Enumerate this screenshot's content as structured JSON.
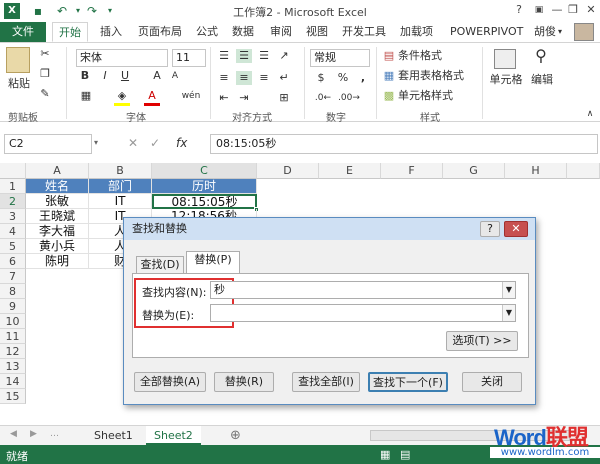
{
  "window": {
    "title": "工作簿2 - Microsoft Excel",
    "help": "?",
    "minimize": "—",
    "restore": "❐",
    "close": "✕"
  },
  "ribbon_tabs": {
    "file": "文件",
    "items": [
      "开始",
      "插入",
      "页面布局",
      "公式",
      "数据",
      "审阅",
      "视图",
      "开发工具",
      "加载项",
      "POWERPIVOT"
    ],
    "user": "胡俊"
  },
  "ribbon": {
    "paste": "粘贴",
    "clipboard": "剪贴板",
    "font_name": "宋体",
    "font_size": "11",
    "bold": "B",
    "italic": "I",
    "underline": "U",
    "font_color_letter": "A",
    "pinyin": "wén",
    "font_group": "字体",
    "align_group": "对齐方式",
    "number_format": "常规",
    "percent": "%",
    "comma": ",",
    "number_group": "数字",
    "cond_format": "条件格式",
    "table_format": "套用表格格式",
    "cell_style": "单元格样式",
    "style_group": "样式",
    "cells": "单元格",
    "edit": "编辑"
  },
  "formula_bar": {
    "name_box": "C2",
    "cancel": "✕",
    "enter": "✓",
    "fx": "fx",
    "value": "08:15:05秒"
  },
  "sheet": {
    "columns": [
      "A",
      "B",
      "C",
      "D",
      "E",
      "F",
      "G",
      "H"
    ],
    "rows": [
      "1",
      "2",
      "3",
      "4",
      "5",
      "6",
      "7",
      "8",
      "9",
      "10",
      "11",
      "12",
      "13",
      "14",
      "15"
    ],
    "headers": [
      "姓名",
      "部门",
      "历时"
    ],
    "data": [
      [
        "张敏",
        "IT",
        "08:15:05秒"
      ],
      [
        "王晓斌",
        "IT",
        "12:18:56秒"
      ],
      [
        "李大福",
        "人",
        ""
      ],
      [
        "黄小兵",
        "人",
        ""
      ],
      [
        "陈明",
        "财",
        ""
      ]
    ]
  },
  "sheet_tabs": {
    "items": [
      "Sheet1",
      "Sheet2"
    ],
    "active": "Sheet2",
    "add": "⊕"
  },
  "status": {
    "ready": "就绪"
  },
  "watermark": {
    "brand_a": "Word",
    "brand_b": "联盟",
    "url": "www.wordlm.com"
  },
  "dialog": {
    "title": "查找和替换",
    "help": "?",
    "close": "✕",
    "tabs": [
      "查找(D)",
      "替换(P)"
    ],
    "find_label": "查找内容(N):",
    "find_value": "秒",
    "replace_label": "替换为(E):",
    "replace_value": "",
    "options": "选项(T) >>",
    "replace_all": "全部替换(A)",
    "replace": "替换(R)",
    "find_all": "查找全部(I)",
    "find_next": "查找下一个(F)",
    "close_btn": "关闭"
  },
  "colors": {
    "excel_green": "#217346",
    "header_blue": "#4f81bd",
    "highlight_red": "#e03030"
  }
}
